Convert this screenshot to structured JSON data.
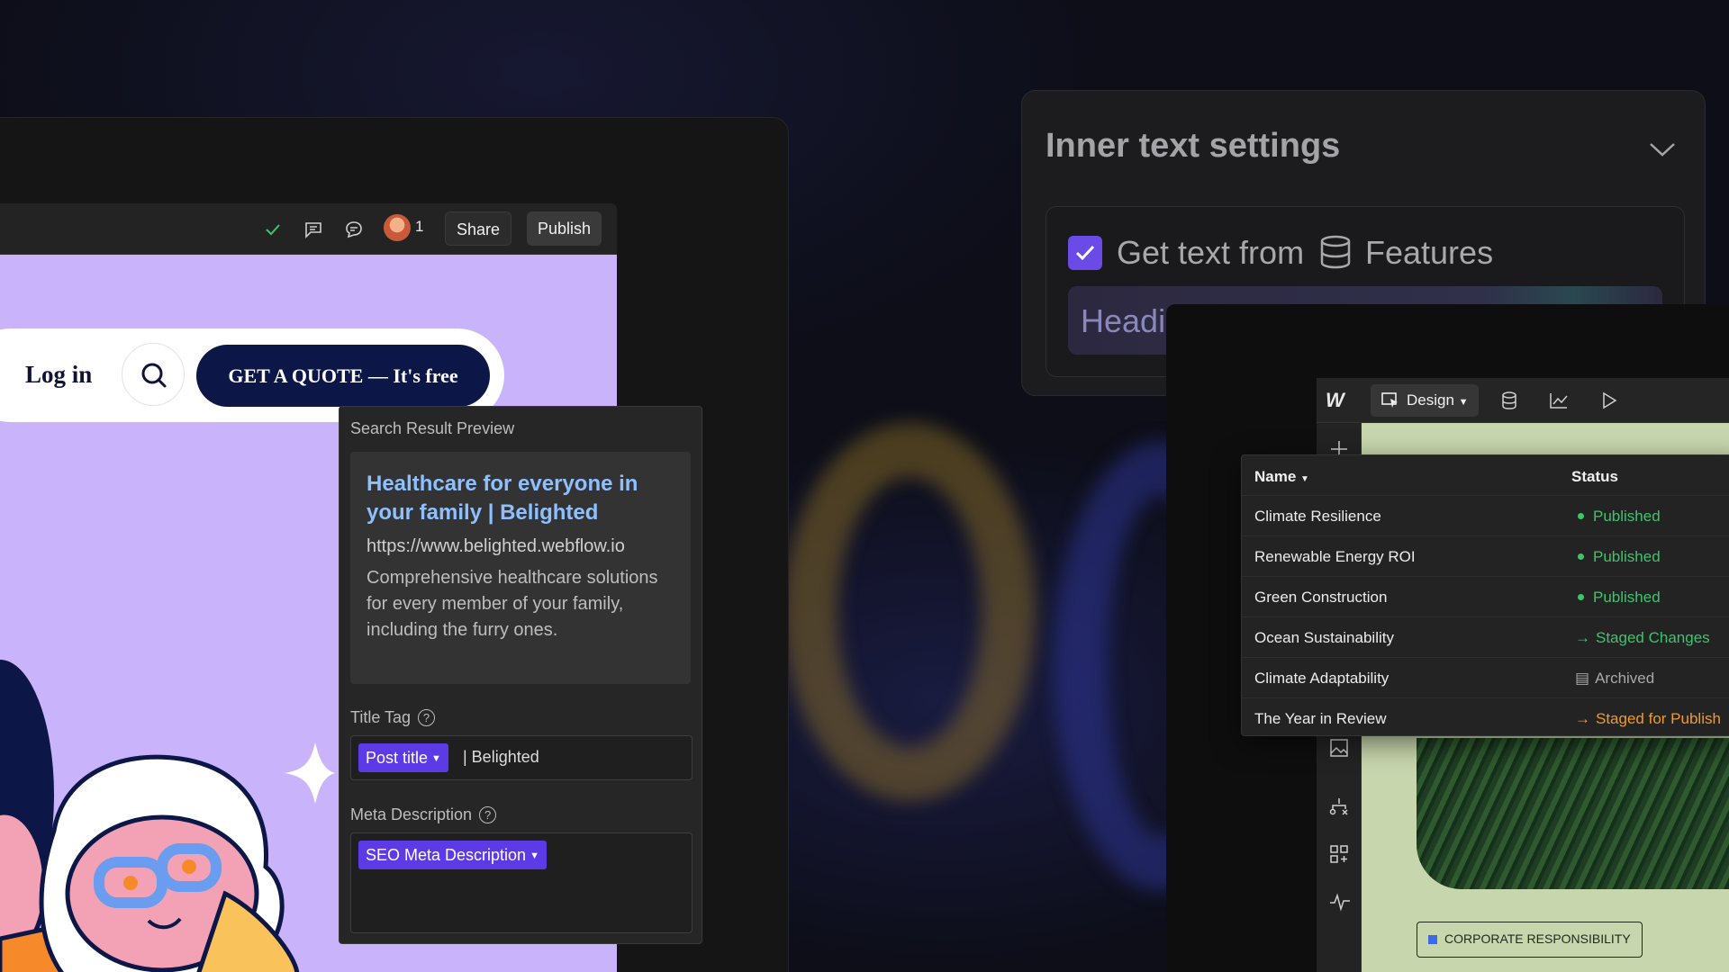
{
  "toolbar": {
    "avatar_count": "1",
    "share_label": "Share",
    "publish_label": "Publish"
  },
  "site_nav": {
    "login_label": "Log in",
    "quote_label": "GET A QUOTE — It's free"
  },
  "seo_panel": {
    "header": "Search Result Preview",
    "preview": {
      "title": "Healthcare for everyone in your family | Belighted",
      "url": "https://www.belighted.webflow.io",
      "description": "Comprehensive healthcare solutions for every member of your family, including the furry ones."
    },
    "title_tag": {
      "label": "Title Tag",
      "chip": "Post title",
      "suffix": "| Belighted"
    },
    "meta_description": {
      "label": "Meta Description",
      "chip": "SEO Meta Description"
    }
  },
  "inner_text_settings": {
    "title": "Inner text settings",
    "get_text_label": "Get text from",
    "source": "Features",
    "field_value": "Headi"
  },
  "cms": {
    "logo": "W",
    "mode_label": "Design",
    "table": {
      "col_name": "Name",
      "col_status": "Status",
      "rows": [
        {
          "name": "Climate Resilience",
          "status": "Published",
          "kind": "published",
          "color": "#3ec46d"
        },
        {
          "name": "Renewable Energy ROI",
          "status": "Published",
          "kind": "published",
          "color": "#3ec46d"
        },
        {
          "name": "Green Construction",
          "status": "Published",
          "kind": "published",
          "color": "#3ec46d"
        },
        {
          "name": "Ocean Sustainability",
          "status": "Staged Changes",
          "kind": "staged",
          "color": "#3ec46d"
        },
        {
          "name": "Climate Adaptability",
          "status": "Archived",
          "kind": "archived",
          "color": "#a8a8a8"
        },
        {
          "name": "The Year in Review",
          "status": "Staged for Publish",
          "kind": "staged",
          "color": "#f59a23"
        }
      ]
    },
    "badge": "CORPORATE RESPONSIBILITY"
  },
  "colors": {
    "accent_purple": "#5c3be6",
    "link_blue": "#8ec0ff",
    "published_green": "#3ec46d",
    "staged_orange": "#f59a23"
  }
}
